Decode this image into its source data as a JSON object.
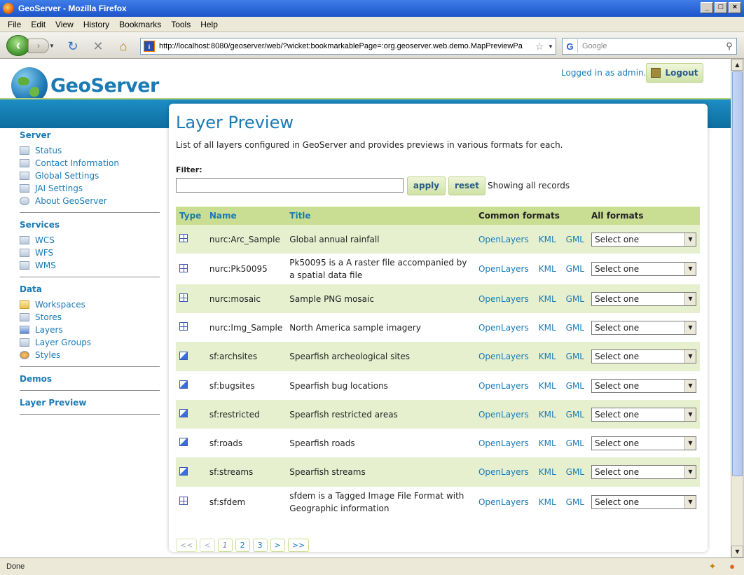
{
  "window": {
    "title": "GeoServer - Mozilla Firefox"
  },
  "menu": [
    "File",
    "Edit",
    "View",
    "History",
    "Bookmarks",
    "Tools",
    "Help"
  ],
  "nav": {
    "url": "http://localhost:8080/geoserver/web/?wicket:bookmarkablePage=:org.geoserver.web.demo.MapPreviewPa",
    "search_placeholder": "Google"
  },
  "status": {
    "text": "Done"
  },
  "header": {
    "logo_text": "GeoServer",
    "logged_in": "Logged in as admin.",
    "logout_label": "Logout"
  },
  "sidebar": {
    "server": {
      "title": "Server",
      "items": [
        "Status",
        "Contact Information",
        "Global Settings",
        "JAI Settings",
        "About GeoServer"
      ]
    },
    "services": {
      "title": "Services",
      "items": [
        "WCS",
        "WFS",
        "WMS"
      ]
    },
    "data": {
      "title": "Data",
      "items": [
        "Workspaces",
        "Stores",
        "Layers",
        "Layer Groups",
        "Styles"
      ]
    },
    "demos": "Demos",
    "layer_preview": "Layer Preview"
  },
  "page": {
    "title": "Layer Preview",
    "description": "List of all layers configured in GeoServer and provides previews in various formats for each.",
    "filter_label": "Filter:",
    "apply_label": "apply",
    "reset_label": "reset",
    "showing": "Showing all records"
  },
  "table": {
    "headers": {
      "type": "Type",
      "name": "Name",
      "title": "Title",
      "common": "Common formats",
      "all": "All formats"
    },
    "format_links": [
      "OpenLayers",
      "KML",
      "GML"
    ],
    "select_default": "Select one",
    "rows": [
      {
        "type": "raster",
        "name": "nurc:Arc_Sample",
        "title": "Global annual rainfall"
      },
      {
        "type": "raster",
        "name": "nurc:Pk50095",
        "title": "Pk50095 is a A raster file accompanied by a spatial data file"
      },
      {
        "type": "raster",
        "name": "nurc:mosaic",
        "title": "Sample PNG mosaic"
      },
      {
        "type": "raster",
        "name": "nurc:Img_Sample",
        "title": "North America sample imagery"
      },
      {
        "type": "vector",
        "name": "sf:archsites",
        "title": "Spearfish archeological sites"
      },
      {
        "type": "vector",
        "name": "sf:bugsites",
        "title": "Spearfish bug locations"
      },
      {
        "type": "vector",
        "name": "sf:restricted",
        "title": "Spearfish restricted areas"
      },
      {
        "type": "vector",
        "name": "sf:roads",
        "title": "Spearfish roads"
      },
      {
        "type": "vector",
        "name": "sf:streams",
        "title": "Spearfish streams"
      },
      {
        "type": "raster",
        "name": "sf:sfdem",
        "title": "sfdem is a Tagged Image File Format with Geographic information"
      }
    ]
  },
  "pager": [
    {
      "label": "<<",
      "state": "disabled"
    },
    {
      "label": "<",
      "state": "disabled"
    },
    {
      "label": "1",
      "state": "current"
    },
    {
      "label": "2",
      "state": "link"
    },
    {
      "label": "3",
      "state": "link"
    },
    {
      "label": ">",
      "state": "link"
    },
    {
      "label": ">>",
      "state": "link"
    }
  ]
}
